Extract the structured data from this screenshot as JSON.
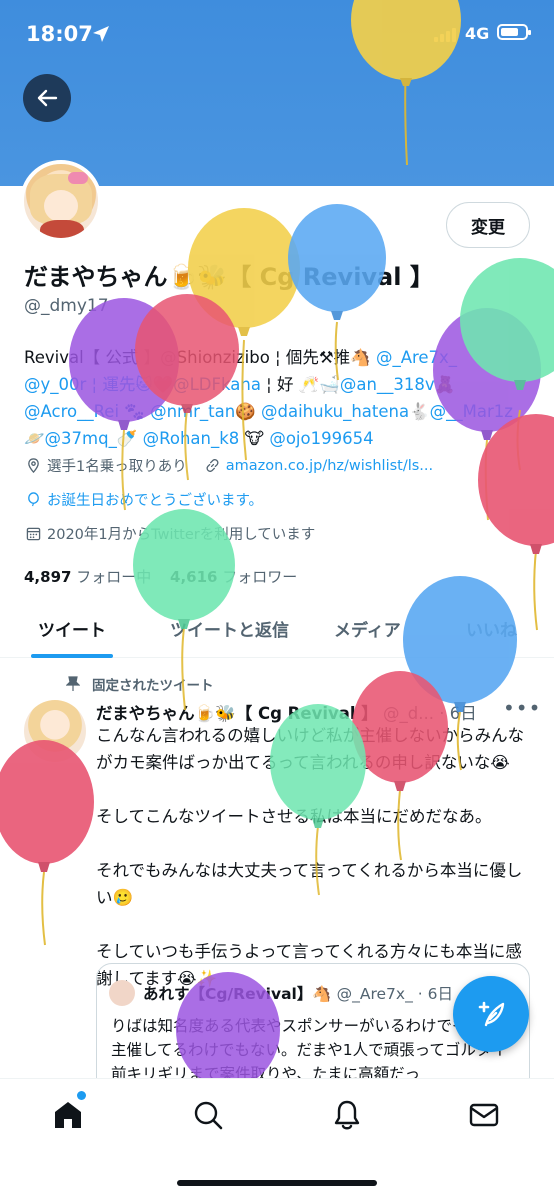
{
  "status_bar": {
    "time": "18:07",
    "network": "4G"
  },
  "profile": {
    "edit_label": "変更",
    "name": "だまやちゃん🍺🐝【 Cg Revival 】",
    "handle": "@_dmy17",
    "bio_1": "Revival【 公式 】@Shionzizibo ¦ 個先⚒推🐴 ",
    "bio_link_1": "@_Are7x_",
    "bio_2": "@y_00r ¦ 運先🐱❤️",
    "bio_link_2": "@LDFkana",
    "bio_3": " ¦ 好 🥂🛁",
    "bio_link_3": "@an__318v",
    "bio_4": "🧸 ",
    "bio_link_4": "@Acro__Rei",
    "bio_5": " 🐾 ",
    "bio_link_5": "@nmr_tan",
    "bio_6": "🍪 ",
    "bio_link_6": "@daihuku_hatena",
    "bio_7": "🐇",
    "bio_link_7": "@__Mar1z",
    "bio_8": "🪐",
    "bio_link_8": "@37mq_",
    "bio_9": "🍼 ",
    "bio_link_9": "@Rohan_k8",
    "bio_10": " 🐮 ",
    "bio_link_10": "@ojo199654",
    "location": "選手1名乗っ取りあり",
    "website": "amazon.co.jp/hz/wishlist/ls...",
    "birthday": "お誕生日おめでとうございます。",
    "joined": "2020年1月からTwitterを利用しています",
    "following_count": "4,897",
    "following_label": "フォロー中",
    "followers_count": "4,616",
    "followers_label": "フォロワー"
  },
  "tabs": [
    "ツイート",
    "ツイートと返信",
    "メディア",
    "いいね"
  ],
  "pinned_label": "固定されたツイート",
  "tweet": {
    "author": "だまやちゃん🍺🐝【 Cg Revival 】",
    "handle": "@_d...",
    "time": "6日",
    "more": "•••",
    "p1": "こんなん言われるの嬉しいけど私が主催しないからみんながカモ案件ばっか出てるって言われるの申し訳ないな😭",
    "p2": "そしてこんなツイートさせる私は本当にだめだなあ。",
    "p3": "それでもみんなは大丈夫って言ってくれるから本当に優しい🥲",
    "p4": "そしていつも手伝うよって言ってくれる方々にも本当に感謝してます😭✨"
  },
  "quote": {
    "author": "あれす【Cg/Revival】🐴",
    "handle": "@_Are7x_ · 6日",
    "text": "りばは知名度ある代表やスポンサーがいるわけでもなく、主催してるわけでもない。だまや1人で頑張ってゴルタイ前キリギリまで案件取りや、たまに高額だっ"
  },
  "icons": {
    "back": "arrow-left-icon",
    "home": "home-icon",
    "search": "search-icon",
    "notifications": "bell-icon",
    "messages": "mail-icon",
    "compose": "feather-plus-icon"
  },
  "colors": {
    "banner": "#4a95e0",
    "accent": "#1d9bf0",
    "balloon_yellow": "#f2cf4a",
    "balloon_blue": "#5aa8f2",
    "balloon_purple": "#9b55e0",
    "balloon_red": "#e85572",
    "balloon_green": "#6ee6b0"
  }
}
